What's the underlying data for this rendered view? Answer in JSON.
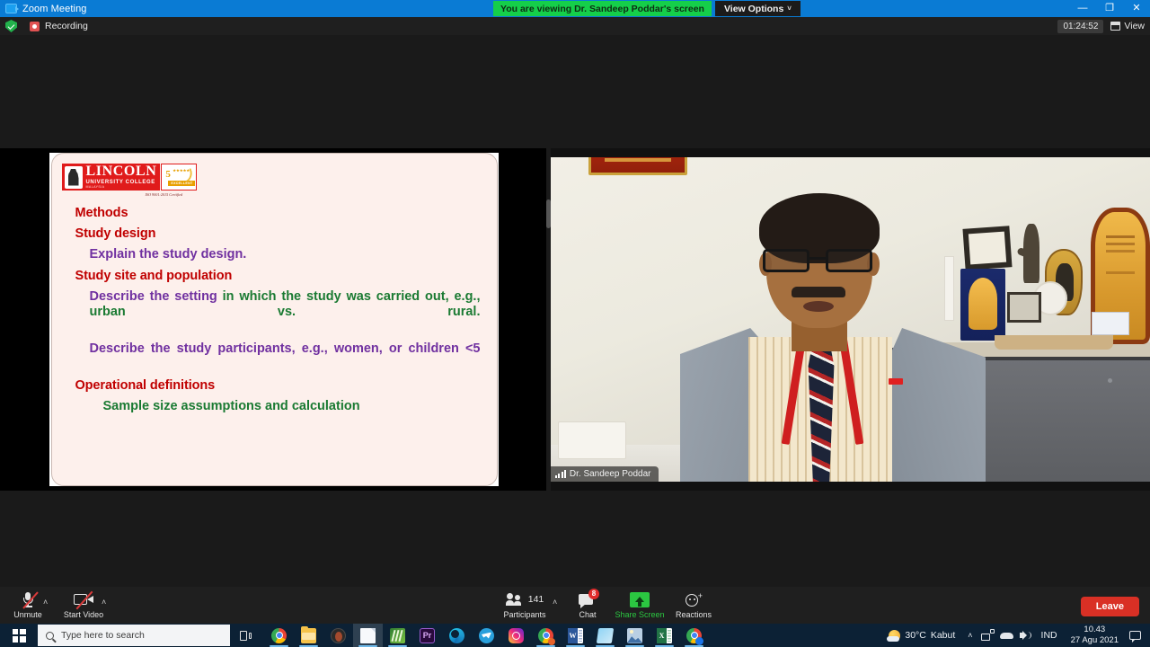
{
  "window": {
    "app_title": "Zoom Meeting",
    "app_icon": "video-camera-icon",
    "minimize_glyph": "—",
    "maximize_glyph": "❐",
    "close_glyph": "✕"
  },
  "share_banner": {
    "text": "You are viewing Dr. Sandeep Poddar's screen",
    "view_options_label": "View Options",
    "caret": "˅",
    "banner_color": "#15cf4a"
  },
  "recording_bar": {
    "shield_icon": "shield-check-icon",
    "record_icon": "record-stop-icon",
    "label": "Recording",
    "timer": "01:24:52",
    "view_label": "View",
    "view_icon": "grid-view-icon"
  },
  "slide": {
    "logo": {
      "name": "LINCOLN",
      "subtitle": "UNIVERSITY COLLEGE",
      "tagline": "MALAYSIA",
      "badge_number": "5",
      "badge_stars": "★★★★★",
      "badge_excellent": "EXCELLENT",
      "iso_note": "ISO 9001:2015 Certified"
    },
    "lines": [
      {
        "text": "Methods",
        "style": "head"
      },
      {
        "text": "Study design",
        "style": "head"
      },
      {
        "text": "Explain the study design.",
        "style": "sub-purple"
      },
      {
        "text": "Study site and population",
        "style": "head"
      },
      {
        "text": "Describe the setting",
        "text2": " in which the study was carried out, e.g., urban vs. rural.",
        "style": "justify-mixed"
      },
      {
        "text": "Describe the study participants, e.g., women, or children <5",
        "style": "justify-purple"
      },
      {
        "text": "Operational definitions",
        "style": "head"
      },
      {
        "text": "Sample size assumptions and calculation",
        "style": "green"
      }
    ],
    "colors": {
      "heading": "#c00000",
      "purple": "#7030a0",
      "green": "#1a7a32",
      "background": "#fdf0ec"
    }
  },
  "video": {
    "participant_name": "Dr. Sandeep Poddar",
    "signal_icon": "signal-strength-icon"
  },
  "toolbar": {
    "mute": {
      "label": "Unmute",
      "icon": "microphone-muted-icon",
      "chevron": "˄"
    },
    "video": {
      "label": "Start Video",
      "icon": "camera-off-icon",
      "chevron": "˄"
    },
    "participants": {
      "label": "Participants",
      "count": "141",
      "icon": "people-icon",
      "chevron": "˄"
    },
    "chat": {
      "label": "Chat",
      "icon": "chat-bubble-icon",
      "badge": "8"
    },
    "share": {
      "label": "Share Screen",
      "icon": "share-screen-icon",
      "color": "#2bc741"
    },
    "reactions": {
      "label": "Reactions",
      "icon": "smiley-plus-icon"
    },
    "leave": {
      "label": "Leave",
      "color": "#d93025"
    }
  },
  "taskbar": {
    "start_icon": "windows-start-icon",
    "search_placeholder": "Type here to search",
    "search_icon": "search-icon",
    "taskview_icon": "task-view-icon",
    "apps": [
      {
        "name": "google-chrome",
        "icon": "chrome-icon",
        "open": true,
        "active": false
      },
      {
        "name": "file-explorer",
        "icon": "folder-icon",
        "open": true,
        "active": false
      },
      {
        "name": "unknown-dark-app",
        "icon": "dark-circle-icon",
        "open": false,
        "active": false
      },
      {
        "name": "document-app",
        "icon": "document-icon",
        "open": true,
        "active": true
      },
      {
        "name": "green-leaf-app",
        "icon": "leaf-icon",
        "open": true,
        "active": false
      },
      {
        "name": "premiere-pro",
        "icon": "premiere-pro-icon",
        "open": false,
        "active": false
      },
      {
        "name": "microsoft-edge",
        "icon": "edge-icon",
        "open": false,
        "active": false
      },
      {
        "name": "telegram",
        "icon": "telegram-icon",
        "open": false,
        "active": false
      },
      {
        "name": "instagram",
        "icon": "instagram-icon",
        "open": false,
        "active": false
      },
      {
        "name": "chrome-beta",
        "icon": "chrome-beta-icon",
        "open": true,
        "active": false
      },
      {
        "name": "microsoft-word",
        "icon": "word-icon",
        "open": true,
        "active": false
      },
      {
        "name": "microsoft-teams",
        "icon": "teams-icon",
        "open": true,
        "active": false
      },
      {
        "name": "photos",
        "icon": "photos-icon",
        "open": true,
        "active": false
      },
      {
        "name": "microsoft-excel",
        "icon": "excel-icon",
        "open": true,
        "active": false
      },
      {
        "name": "chrome-download",
        "icon": "chrome-dl-icon",
        "open": true,
        "active": false
      }
    ],
    "weather_temp": "30°C",
    "weather_desc": "Kabut",
    "weather_icon": "sun-cloud-icon",
    "tray_chevron": "˄",
    "tray_icons": [
      "network-icon",
      "onedrive-icon",
      "volume-icon"
    ],
    "language": "IND",
    "clock_time": "10.43",
    "clock_date": "27 Agu 2021",
    "notification_icon": "notification-icon"
  }
}
